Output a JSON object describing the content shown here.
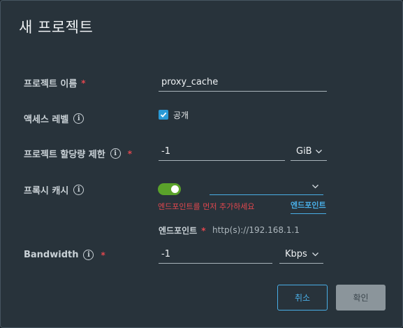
{
  "dialog": {
    "title": "새 프로젝트"
  },
  "fields": {
    "project_name": {
      "label": "프로젝트 이름",
      "required": "*",
      "value": "proxy_cache"
    },
    "access_level": {
      "label": "액세스 레벨",
      "checkbox_label": "공개",
      "checked": true
    },
    "quota": {
      "label": "프로젝트 할당량 제한",
      "required": "*",
      "value": "-1",
      "unit": "GiB"
    },
    "proxy_cache": {
      "label": "프록시 캐시",
      "enabled": true,
      "endpoint_select_value": "",
      "error": "엔드포인트를 먼저 추가하세요",
      "endpoint_link": "엔드포인트",
      "endpoint_label": "엔드포인트",
      "endpoint_required": "*",
      "endpoint_placeholder": "http(s)://192.168.1.1"
    },
    "bandwidth": {
      "label": "Bandwidth",
      "required": "*",
      "value": "-1",
      "unit": "Kbps"
    }
  },
  "buttons": {
    "cancel": "취소",
    "confirm": "확인"
  },
  "colors": {
    "background": "#28333b",
    "accent": "#2a9ad6",
    "toggle_on": "#5aa22a",
    "error": "#e2474e"
  }
}
